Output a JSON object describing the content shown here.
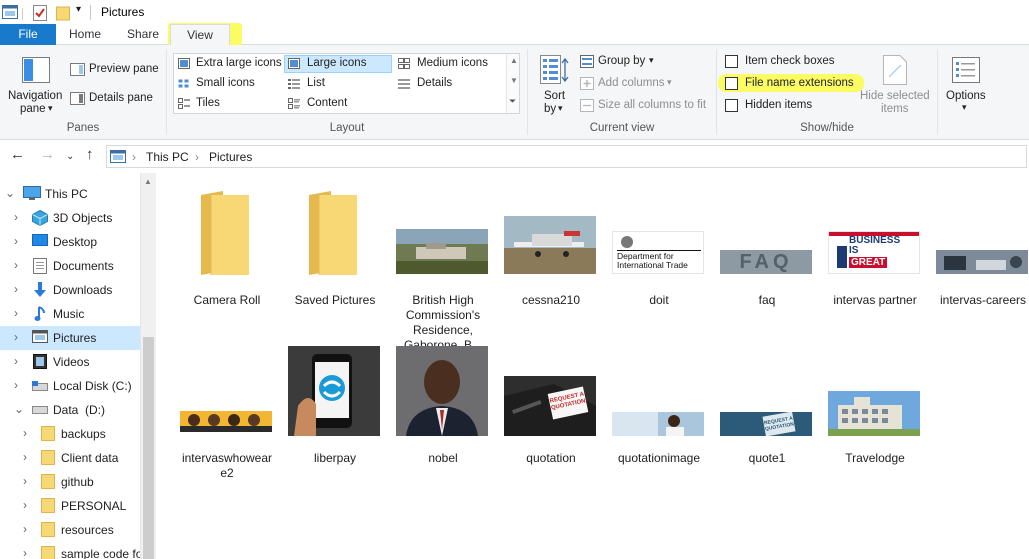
{
  "window": {
    "title": "Pictures"
  },
  "tabs": {
    "file": "File",
    "home": "Home",
    "share": "Share",
    "view": "View"
  },
  "ribbon": {
    "panes": {
      "navigation_pane": "Navigation pane",
      "navigation_pane_line1": "Navigation",
      "navigation_pane_line2": "pane",
      "preview_pane": "Preview pane",
      "details_pane": "Details pane",
      "group_label": "Panes"
    },
    "layout": {
      "items": [
        "Extra large icons",
        "Large icons",
        "Medium icons",
        "Small icons",
        "List",
        "Details",
        "Tiles",
        "Content"
      ],
      "selected": "Large icons",
      "group_label": "Layout"
    },
    "current_view": {
      "sort_by_line1": "Sort",
      "sort_by_line2": "by",
      "group_by": "Group by",
      "add_columns": "Add columns",
      "size_columns": "Size all columns to fit",
      "group_label": "Current view"
    },
    "show_hide": {
      "item_check_boxes": "Item check boxes",
      "file_name_extensions": "File name extensions",
      "hidden_items": "Hidden items",
      "hide_selected_line1": "Hide selected",
      "hide_selected_line2": "items",
      "group_label": "Show/hide"
    },
    "options": {
      "label": "Options"
    }
  },
  "address": {
    "crumbs": [
      "This PC",
      "Pictures"
    ]
  },
  "nav": {
    "items": [
      {
        "label": "This PC",
        "icon": "computer-icon"
      },
      {
        "label": "3D Objects",
        "icon": "3d-objects-icon"
      },
      {
        "label": "Desktop",
        "icon": "desktop-icon"
      },
      {
        "label": "Documents",
        "icon": "documents-icon"
      },
      {
        "label": "Downloads",
        "icon": "downloads-icon"
      },
      {
        "label": "Music",
        "icon": "music-icon"
      },
      {
        "label": "Pictures",
        "icon": "pictures-icon"
      },
      {
        "label": "Videos",
        "icon": "videos-icon"
      },
      {
        "label": "Local Disk (C:)",
        "icon": "drive-icon"
      },
      {
        "label": "Data  (D:)",
        "icon": "drive-icon"
      },
      {
        "label": "backups",
        "icon": "folder-icon"
      },
      {
        "label": "Client data",
        "icon": "folder-icon"
      },
      {
        "label": "github",
        "icon": "folder-icon"
      },
      {
        "label": "PERSONAL",
        "icon": "folder-icon"
      },
      {
        "label": "resources",
        "icon": "folder-icon"
      },
      {
        "label": "sample code fo",
        "icon": "folder-icon"
      }
    ],
    "selected": "Pictures"
  },
  "files": [
    {
      "name": "Camera Roll",
      "type": "folder"
    },
    {
      "name": "Saved Pictures",
      "type": "folder"
    },
    {
      "name": "British High Commission's Residence, Gaborone, B...",
      "lines": [
        "British High",
        "Commission's",
        "Residence,",
        "Gaborone, B..."
      ],
      "type": "image"
    },
    {
      "name": "cessna210",
      "type": "image"
    },
    {
      "name": "doit",
      "type": "image",
      "text": [
        "Department for",
        "International Trade"
      ]
    },
    {
      "name": "faq",
      "type": "image",
      "text": [
        "FAQ"
      ]
    },
    {
      "name": "intervas partner",
      "type": "image",
      "text": [
        "BUSINESS",
        "IS",
        "GREAT"
      ]
    },
    {
      "name": "intervas-careers",
      "type": "image"
    },
    {
      "name": "intervaswhowear e2",
      "lines": [
        "intervaswhowear",
        "e2"
      ],
      "type": "image"
    },
    {
      "name": "liberpay",
      "type": "image"
    },
    {
      "name": "nobel",
      "type": "image"
    },
    {
      "name": "quotation",
      "type": "image",
      "text": [
        "REQUEST A",
        "QUOTATION"
      ]
    },
    {
      "name": "quotationimage",
      "type": "image"
    },
    {
      "name": "quote1",
      "type": "image",
      "text": [
        "REQUEST A",
        "QUOTATION"
      ]
    },
    {
      "name": "Travelodge",
      "type": "image"
    }
  ],
  "colors": {
    "accent": "#1979ca",
    "selection": "#cce8ff",
    "highlight": "#fbfb63",
    "folder": "#f8d775"
  }
}
